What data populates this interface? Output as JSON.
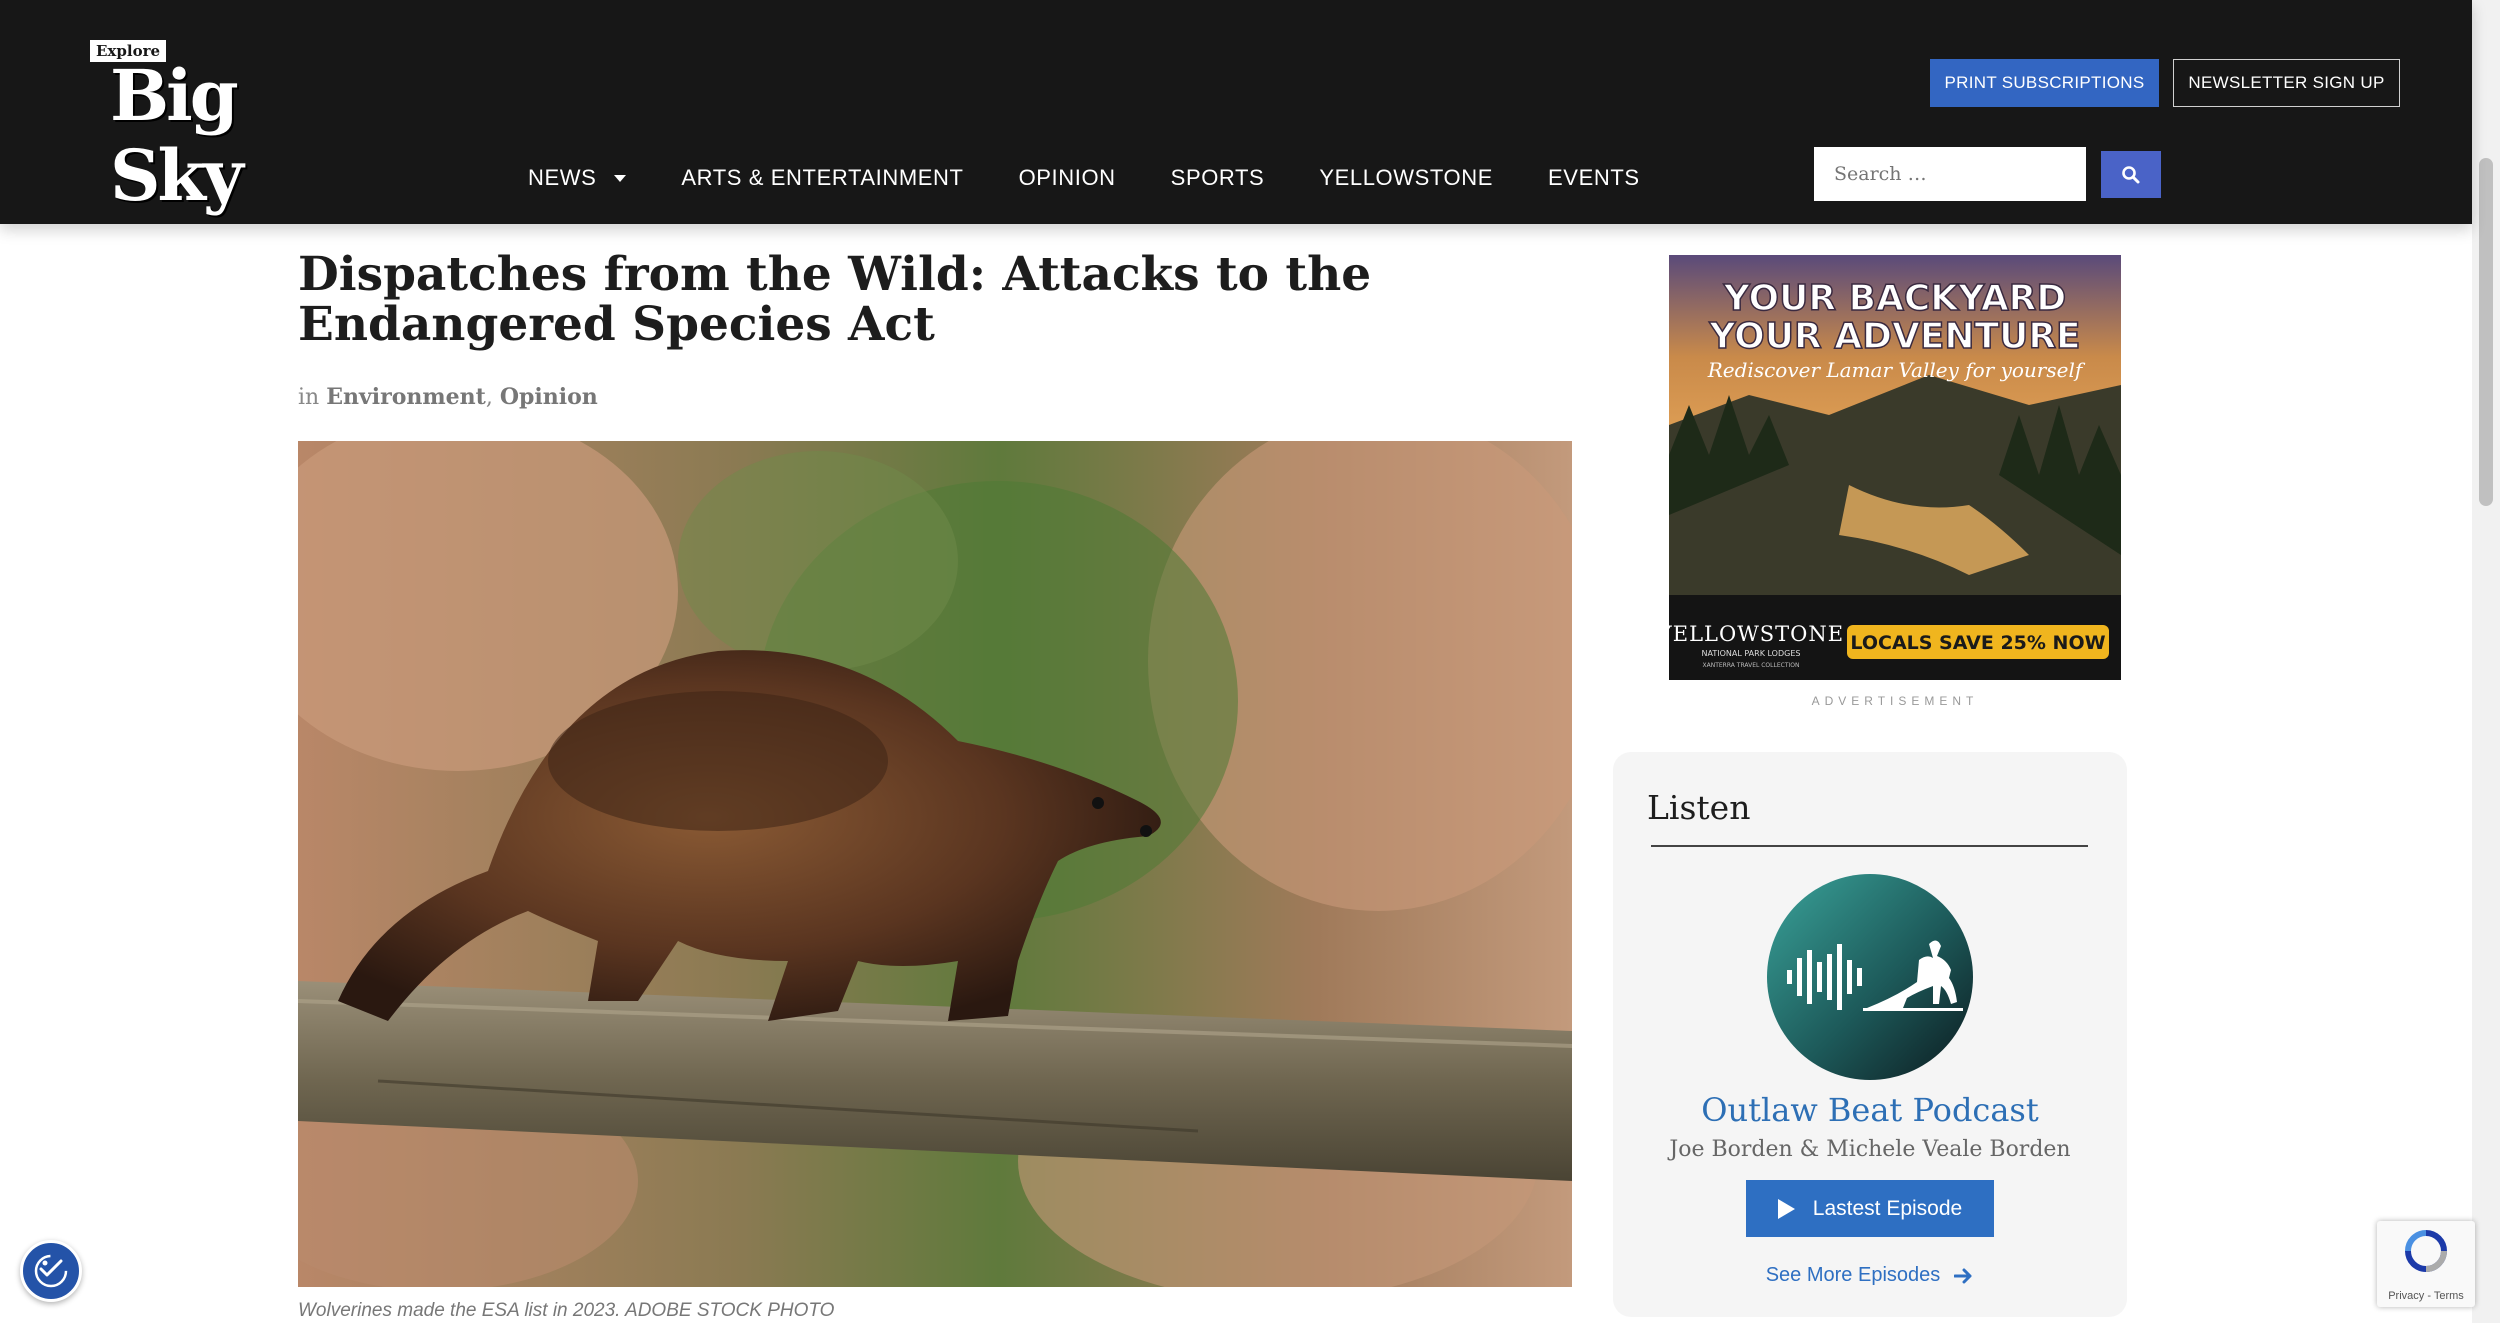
{
  "header": {
    "logo": {
      "small": "Explore",
      "main": "Big Sky"
    },
    "buttons": {
      "print": "PRINT SUBSCRIPTIONS",
      "newsletter": "NEWSLETTER SIGN UP"
    },
    "nav": [
      "NEWS",
      "ARTS & ENTERTAINMENT",
      "OPINION",
      "SPORTS",
      "YELLOWSTONE",
      "EVENTS"
    ],
    "search": {
      "placeholder": "Search …"
    }
  },
  "article": {
    "title": "Dispatches from the Wild: Attacks to the Endangered Species Act",
    "in_label": "in",
    "categories": [
      "Environment",
      "Opinion"
    ],
    "separator": ", ",
    "caption": "Wolverines made the ESA list in 2023. ADOBE STOCK PHOTO"
  },
  "sidebar": {
    "ad": {
      "headline1": "YOUR BACKYARD",
      "headline2": "YOUR ADVENTURE",
      "tagline": "Rediscover Lamar Valley for yourself",
      "brand": "YELLOWSTONE",
      "brand_sub": "NATIONAL PARK LODGES",
      "brand_sub2": "XANTERRA TRAVEL COLLECTION",
      "cta": "LOCALS SAVE 25% NOW",
      "label": "ADVERTISEMENT"
    },
    "listen": {
      "title": "Listen",
      "podcast_title": "Outlaw Beat Podcast",
      "hosts": "Joe Borden & Michele Veale Borden",
      "episode_button": "Lastest Episode",
      "more_link": "See More Episodes"
    }
  },
  "widgets": {
    "recaptcha_legal": "Privacy - Terms"
  },
  "colors": {
    "header_bg": "#171717",
    "accent_blue": "#3366c2",
    "link_blue": "#2d6fb5"
  }
}
